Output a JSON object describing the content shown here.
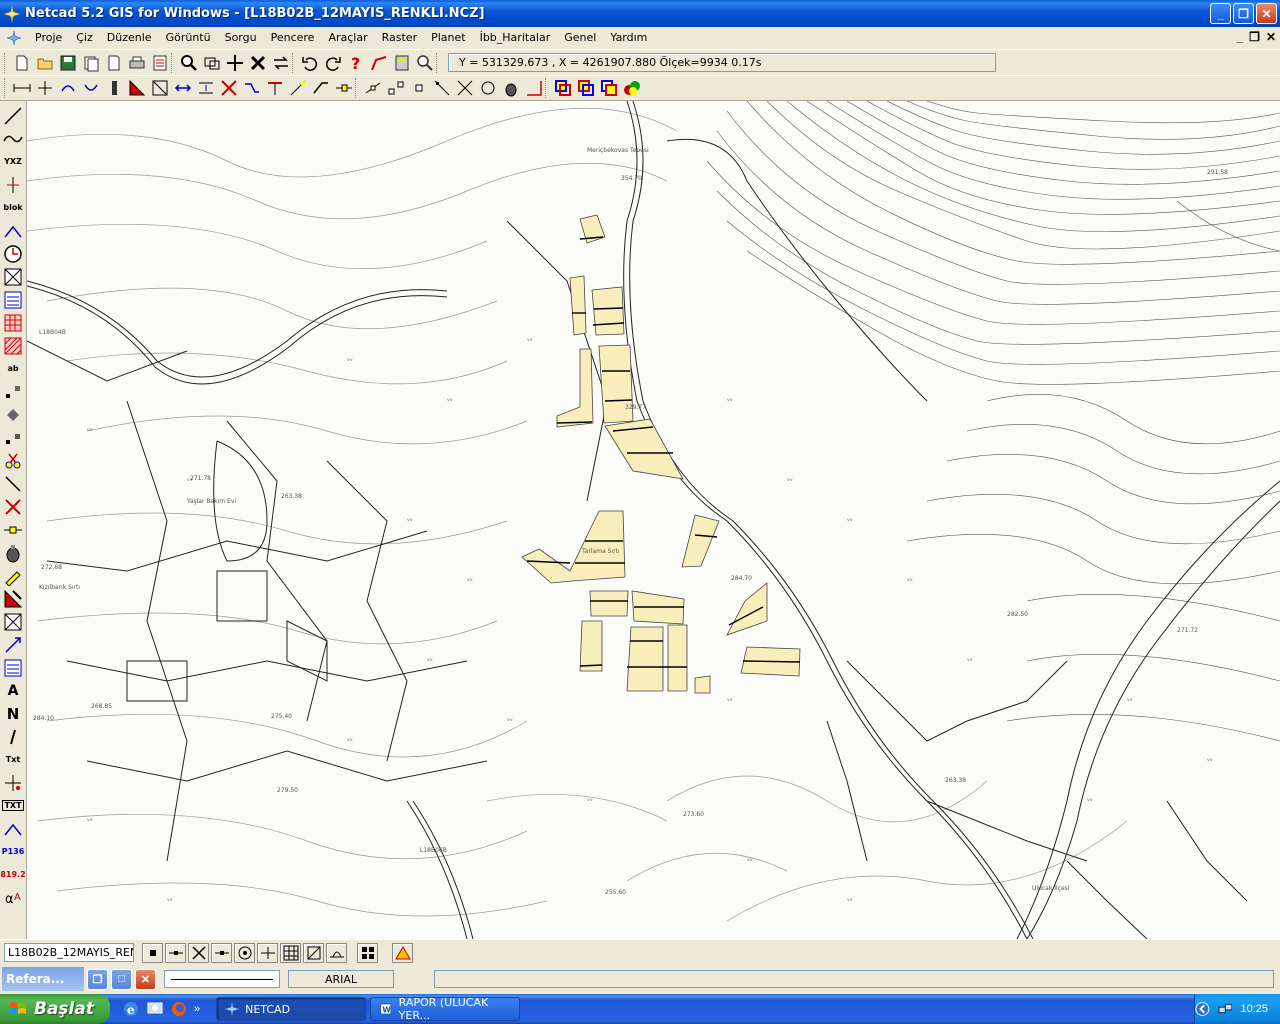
{
  "window": {
    "title": "Netcad 5.2 GIS for Windows - [L18B02B_12MAYIS_RENKLI.NCZ]",
    "min": "_",
    "max": "❐",
    "close": "✕"
  },
  "menu": {
    "items": [
      "Proje",
      "Çiz",
      "Düzenle",
      "Görüntü",
      "Sorgu",
      "Pencere",
      "Araçlar",
      "Raster",
      "Planet",
      "İbb_Haritalar",
      "Genel",
      "Yardım"
    ],
    "mdi_min": "_",
    "mdi_max": "❐",
    "mdi_close": "✕"
  },
  "coords": {
    "text": "Y = 531329.673 , X = 4261907.880  Ölçek=9934   0.17s"
  },
  "left_toolbar": {
    "xyz": "YXZ",
    "blok": "blok",
    "ab": "ab",
    "a": "A",
    "n": "N",
    "txt1": "Txt",
    "txt2": "TXT",
    "p136": "P136",
    "p819": "819.2"
  },
  "map_labels": {
    "tepe": "Meriçbekovas Tepesi",
    "l18": "L18B04B",
    "yasilar": "Yaşlar Bakım Evi",
    "kizilbaruk": "Kızılbarık Sırtı",
    "tarlama": "Tarlama Sırtı",
    "ulucak": "Ulucak İlçesi",
    "l18b": "L18B06B",
    "h1": "354.70",
    "h2": "329.77",
    "h3": "284.70",
    "h4": "271.78",
    "h5": "263.38",
    "h6": "272.68",
    "h7": "268.85",
    "h8": "275.40",
    "h9": "279.50",
    "h10": "255.60",
    "h11": "273.60",
    "h12": "284.10",
    "h13": "263.38",
    "h14": "291.58",
    "h15": "282.50",
    "h16": "271.72"
  },
  "status": {
    "layer": "L18B02B_12MAYIS_RENK",
    "dock_title": "Refera...",
    "font": "ARIAL"
  },
  "taskbar": {
    "start": "Başlat",
    "tasks": [
      "NETCAD",
      "RAPOR (ULUCAK YER..."
    ],
    "clock": "10:25"
  }
}
